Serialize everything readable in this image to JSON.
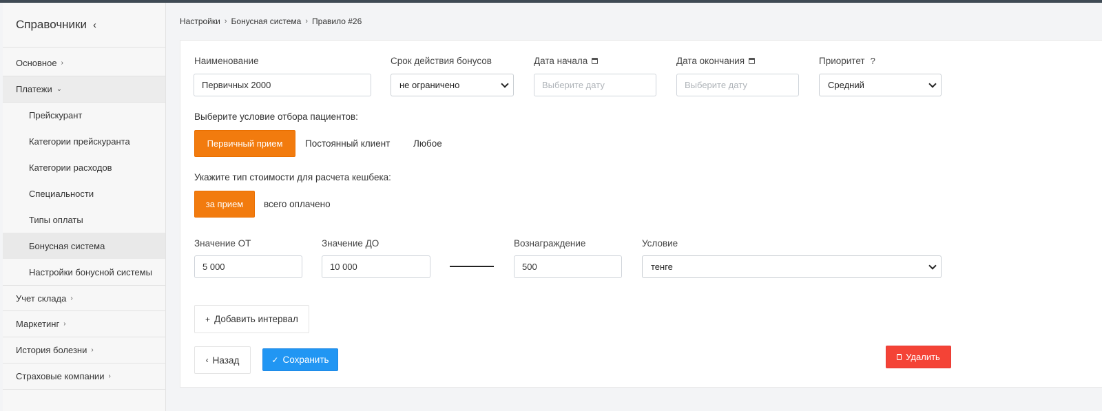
{
  "sidebar": {
    "title": "Справочники",
    "items": [
      {
        "label": "Основное"
      },
      {
        "label": "Платежи"
      },
      {
        "label": "Учет склада"
      },
      {
        "label": "Маркетинг"
      },
      {
        "label": "История болезни"
      },
      {
        "label": "Страховые компании"
      }
    ],
    "payments_sub": [
      {
        "label": "Прейскурант"
      },
      {
        "label": "Категории прейскуранта"
      },
      {
        "label": "Категории расходов"
      },
      {
        "label": "Специальности"
      },
      {
        "label": "Типы оплаты"
      },
      {
        "label": "Бонусная система"
      },
      {
        "label": "Настройки бонусной системы"
      }
    ]
  },
  "breadcrumb": [
    "Настройки",
    "Бонусная система",
    "Правило #26"
  ],
  "form": {
    "name_label": "Наименование",
    "name_value": "Первичных 2000",
    "validity_label": "Срок действия бонусов",
    "validity_value": "не ограничено",
    "start_label": "Дата начала",
    "start_placeholder": "Выберите дату",
    "end_label": "Дата окончания",
    "end_placeholder": "Выберите дату",
    "priority_label": "Приоритет",
    "priority_hint": "?",
    "priority_value": "Средний",
    "patient_condition_label": "Выберите условие отбора пациентов:",
    "patient_options": [
      "Первичный прием",
      "Постоянный клиент",
      "Любое"
    ],
    "patient_selected": "Первичный прием",
    "cost_type_label": "Укажите тип стоимости для расчета кешбека:",
    "cost_options": [
      "за прием",
      "всего оплачено"
    ],
    "cost_selected": "за прием",
    "from_label": "Значение ОТ",
    "from_value": "5 000",
    "to_label": "Значение ДО",
    "to_value": "10 000",
    "reward_label": "Вознаграждение",
    "reward_value": "500",
    "condition_label": "Условие",
    "condition_value": "тенге"
  },
  "actions": {
    "add_interval": "Добавить интервал",
    "back": "Назад",
    "save": "Сохранить",
    "delete": "Удалить"
  },
  "colors": {
    "accent_orange": "#f27b0e",
    "save_blue": "#2196f3",
    "delete_red": "#f44336"
  }
}
